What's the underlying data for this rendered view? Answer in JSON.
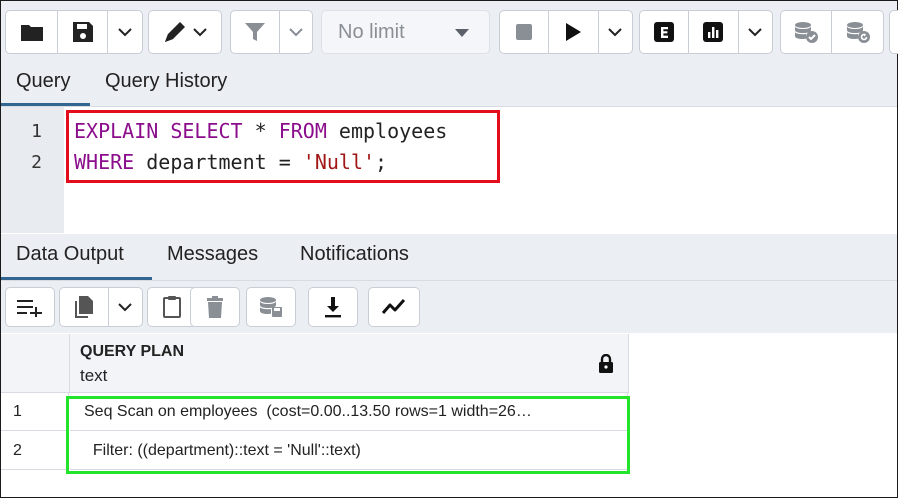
{
  "toolbar": {
    "limit": {
      "selected": "No limit"
    },
    "icons": [
      "folder-icon",
      "save-icon",
      "chevron-down-icon",
      "pen-icon",
      "chevron-down-icon",
      "filter-icon",
      "chevron-down-icon",
      "stop-icon",
      "play-icon",
      "chevron-down-icon",
      "explain-icon",
      "explain-analyze-icon",
      "chevron-down-icon",
      "commit-icon",
      "rollback-icon"
    ]
  },
  "query_tabs": [
    "Query",
    "Query History"
  ],
  "editor": {
    "line_numbers": [
      "1",
      "2"
    ],
    "line1": {
      "kw1": "EXPLAIN",
      "kw2": "SELECT",
      "star": " * ",
      "kw3": "FROM",
      "table": " employees"
    },
    "line2": {
      "kw1": "WHERE",
      "middle": " department = ",
      "string": "'Null'",
      "end": ";"
    }
  },
  "result_tabs": [
    "Data Output",
    "Messages",
    "Notifications"
  ],
  "grid": {
    "column": {
      "name": "QUERY PLAN",
      "type": "text"
    },
    "rows": [
      {
        "num": "1",
        "value": "Seq Scan on employees  (cost=0.00..13.50 rows=1 width=26…"
      },
      {
        "num": "2",
        "value": "  Filter: ((department)::text = 'Null'::text)"
      }
    ]
  },
  "colors": {
    "highlight_red": "#e30d1d",
    "highlight_green": "#22e52b",
    "tab_accent": "#326690",
    "keyword": "#8b0d8b",
    "string": "#a11616"
  }
}
